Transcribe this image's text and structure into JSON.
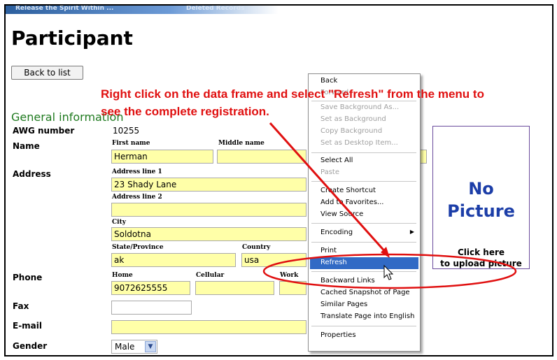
{
  "header_strip": {
    "left": "Release the Spirit Within ...",
    "right": "Deleted Records"
  },
  "page": {
    "title": "Participant",
    "back_button": "Back to list",
    "section": "General information"
  },
  "annotation": {
    "text": "Right click on the data frame and select \"Refresh\" from the menu to see the complete registration."
  },
  "form": {
    "awg_label": "AWG number",
    "awg_value": "10255",
    "name_label": "Name",
    "first_name_label": "First name",
    "first_name": "Herman",
    "middle_name_label": "Middle name",
    "address_label": "Address",
    "addr1_label": "Address line 1",
    "addr1": "23 Shady Lane",
    "addr2_label": "Address line 2",
    "addr2": "",
    "city_label": "City",
    "city": "Soldotna",
    "state_label": "State/Province",
    "state": "ak",
    "country_label": "Country",
    "country": "usa",
    "phone_label": "Phone",
    "home_label": "Home",
    "home": "9072625555",
    "cell_label": "Cellular",
    "cell": "",
    "work_label": "Work",
    "work": "",
    "fax_label": "Fax",
    "fax": "",
    "email_label": "E-mail",
    "email": "",
    "gender_label": "Gender",
    "gender": "Male"
  },
  "photo": {
    "line1": "No",
    "line2": "Picture",
    "click1": "Click here",
    "click2": "to upload picture"
  },
  "context_menu": {
    "items": [
      {
        "label": "Back",
        "disabled": false
      },
      {
        "label": "Forward",
        "disabled": true
      },
      {
        "label": "Save Background As...",
        "disabled": true
      },
      {
        "label": "Set as Background",
        "disabled": true
      },
      {
        "label": "Copy Background",
        "disabled": true
      },
      {
        "label": "Set as Desktop Item...",
        "disabled": true
      },
      {
        "label": "Select All",
        "disabled": false
      },
      {
        "label": "Paste",
        "disabled": true
      },
      {
        "label": "Create Shortcut",
        "disabled": false
      },
      {
        "label": "Add to Favorites...",
        "disabled": false
      },
      {
        "label": "View Source",
        "disabled": false
      },
      {
        "label": "Encoding",
        "disabled": false
      },
      {
        "label": "Print",
        "disabled": false
      },
      {
        "label": "Refresh",
        "disabled": false
      },
      {
        "label": "Backward Links",
        "disabled": false
      },
      {
        "label": "Cached Snapshot of Page",
        "disabled": false
      },
      {
        "label": "Similar Pages",
        "disabled": false
      },
      {
        "label": "Translate Page into English",
        "disabled": false
      },
      {
        "label": "Properties",
        "disabled": false
      }
    ]
  },
  "colors": {
    "field": "#ffffa8",
    "annotation": "#e01010",
    "section": "#1f7a1f",
    "photo_text": "#1c3ea8",
    "menu_highlight": "#316ac5"
  },
  "icons": [
    "mouse-cursor-icon",
    "dropdown-arrow-icon",
    "submenu-arrow-icon"
  ]
}
